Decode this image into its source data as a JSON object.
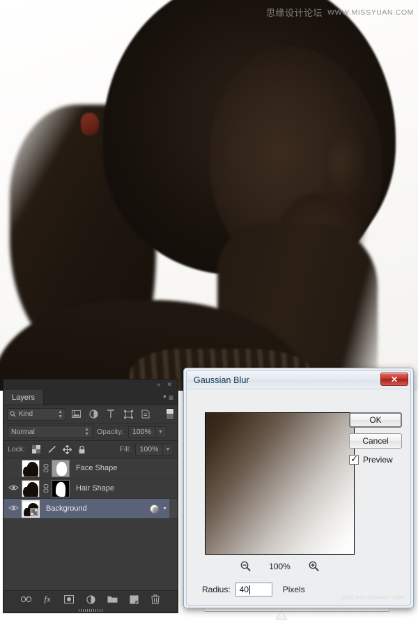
{
  "photo": {
    "watermark_cn": "思缘设计论坛",
    "watermark_en": "WWW.MISSYUAN.COM",
    "alt": "darkened silhouette profile portrait of a woman with a ponytail"
  },
  "layers_panel": {
    "tab_label": "Layers",
    "collapse_icon": "«",
    "close_icon": "✕",
    "menu_icon": "≡",
    "filter": {
      "kind_label": "Kind",
      "search_icon": "search-icon",
      "icons": [
        "pixel-layer-filter-icon",
        "adjustment-layer-filter-icon",
        "type-layer-filter-icon",
        "shape-layer-filter-icon",
        "smart-object-filter-icon"
      ],
      "toggle": "filter-enable-switch"
    },
    "blend": {
      "mode": "Normal",
      "opacity_label": "Opacity:",
      "opacity_value": "100%"
    },
    "lock": {
      "label": "Lock:",
      "icons": [
        "lock-transparent-pixels-icon",
        "lock-image-pixels-icon",
        "lock-position-icon",
        "lock-all-icon"
      ],
      "fill_label": "Fill:",
      "fill_value": "100%"
    },
    "layers": [
      {
        "name": "Face Shape",
        "visible": false,
        "selected": false,
        "has_mask": true,
        "mask_kind": "face",
        "linked": true
      },
      {
        "name": "Hair Shape",
        "visible": true,
        "selected": false,
        "has_mask": true,
        "mask_kind": "hair",
        "linked": true
      },
      {
        "name": "Background",
        "visible": true,
        "selected": true,
        "has_mask": false,
        "mask_kind": "none",
        "linked": false,
        "has_effects": true
      }
    ],
    "footer_icons": [
      "link-layers-icon",
      "layer-style-fx-icon",
      "add-layer-mask-icon",
      "new-adjustment-layer-icon",
      "new-group-icon",
      "new-layer-icon",
      "delete-layer-icon"
    ],
    "fx_label": "fx"
  },
  "dialog": {
    "title": "Gaussian Blur",
    "close_label": "✕",
    "ok_label": "OK",
    "cancel_label": "Cancel",
    "preview_label": "Preview",
    "preview_checked": true,
    "zoom_out_icon": "zoom-out-icon",
    "zoom_in_icon": "zoom-in-icon",
    "zoom_value": "100%",
    "radius_label": "Radius:",
    "radius_value": "40",
    "units_label": "Pixels",
    "watermark": "psd.eduimaker.com"
  }
}
